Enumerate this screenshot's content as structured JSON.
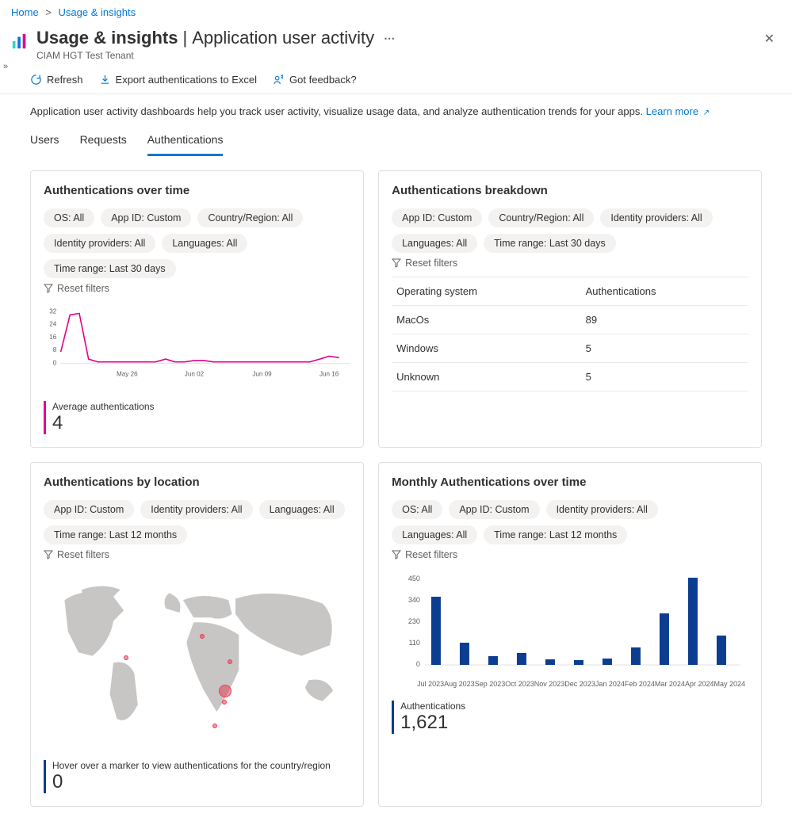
{
  "breadcrumb": {
    "home": "Home",
    "current": "Usage & insights"
  },
  "header": {
    "title_main": "Usage & insights",
    "title_sep": "|",
    "title_sub": "Application user activity",
    "tenant": "CIAM HGT Test Tenant"
  },
  "toolbar": {
    "refresh": "Refresh",
    "export": "Export authentications to Excel",
    "feedback": "Got feedback?"
  },
  "helptext": {
    "text": "Application user activity dashboards help you track user activity, visualize usage data, and analyze authentication trends for your apps.",
    "learn_more": "Learn more"
  },
  "tabs": {
    "users": "Users",
    "requests": "Requests",
    "authentications": "Authentications"
  },
  "card_over_time": {
    "title": "Authentications over time",
    "pills": [
      "OS: All",
      "App ID: Custom",
      "Country/Region: All",
      "Identity providers: All",
      "Languages: All",
      "Time range: Last 30 days"
    ],
    "reset": "Reset filters",
    "metric_label": "Average authentications",
    "metric_value": "4",
    "x_ticks": [
      "May 26",
      "Jun 02",
      "Jun 09",
      "Jun 16"
    ],
    "y_ticks": [
      "32",
      "24",
      "16",
      "8",
      "0"
    ]
  },
  "card_breakdown": {
    "title": "Authentications breakdown",
    "pills": [
      "App ID: Custom",
      "Country/Region: All",
      "Identity providers: All",
      "Languages: All",
      "Time range: Last 30 days"
    ],
    "reset": "Reset filters",
    "col1": "Operating system",
    "col2": "Authentications",
    "rows": [
      {
        "os": "MacOs",
        "count": "89"
      },
      {
        "os": "Windows",
        "count": "5"
      },
      {
        "os": "Unknown",
        "count": "5"
      }
    ]
  },
  "card_location": {
    "title": "Authentications by location",
    "pills": [
      "App ID: Custom",
      "Identity providers: All",
      "Languages: All",
      "Time range: Last 12 months"
    ],
    "reset": "Reset filters",
    "metric_label": "Hover over a marker to view authentications for the country/region",
    "metric_value": "0"
  },
  "card_monthly": {
    "title": "Monthly Authentications over time",
    "pills": [
      "OS: All",
      "App ID: Custom",
      "Identity providers: All",
      "Languages: All",
      "Time range: Last 12 months"
    ],
    "reset": "Reset filters",
    "metric_label": "Authentications",
    "metric_value": "1,621",
    "y_ticks": [
      "450",
      "340",
      "230",
      "110",
      "0"
    ],
    "x_labels": [
      "Jul 2023",
      "Aug 2023",
      "Sep 2023",
      "Oct 2023",
      "Nov 2023",
      "Dec 2023",
      "Jan 2024",
      "Feb 2024",
      "Mar 2024",
      "Apr 2024",
      "May 2024"
    ]
  },
  "chart_data": [
    {
      "type": "line",
      "title": "Authentications over time",
      "x": [
        "May 20",
        "May 21",
        "May 22",
        "May 23",
        "May 24",
        "May 25",
        "May 26",
        "May 27",
        "May 28",
        "May 29",
        "May 30",
        "May 31",
        "Jun 01",
        "Jun 02",
        "Jun 03",
        "Jun 04",
        "Jun 05",
        "Jun 06",
        "Jun 07",
        "Jun 08",
        "Jun 09",
        "Jun 10",
        "Jun 11",
        "Jun 12",
        "Jun 13",
        "Jun 14",
        "Jun 15",
        "Jun 16",
        "Jun 17",
        "Jun 18"
      ],
      "values": [
        7,
        30,
        31,
        3,
        1,
        1,
        1,
        1,
        1,
        1,
        1,
        3,
        1,
        1,
        2,
        2,
        1,
        1,
        1,
        1,
        1,
        1,
        1,
        1,
        1,
        1,
        1,
        3,
        5,
        4
      ],
      "ylim": [
        0,
        32
      ],
      "color": "#e3008c"
    },
    {
      "type": "table",
      "title": "Authentications breakdown",
      "columns": [
        "Operating system",
        "Authentications"
      ],
      "rows": [
        [
          "MacOs",
          89
        ],
        [
          "Windows",
          5
        ],
        [
          "Unknown",
          5
        ]
      ]
    },
    {
      "type": "bar",
      "title": "Monthly Authentications over time",
      "categories": [
        "Jul 2023",
        "Aug 2023",
        "Sep 2023",
        "Oct 2023",
        "Nov 2023",
        "Dec 2023",
        "Jan 2024",
        "Feb 2024",
        "Mar 2024",
        "Apr 2024",
        "May 2024"
      ],
      "values": [
        350,
        112,
        42,
        60,
        28,
        22,
        32,
        90,
        265,
        448,
        150
      ],
      "ylim": [
        0,
        450
      ],
      "color": "#0b3d91"
    }
  ]
}
